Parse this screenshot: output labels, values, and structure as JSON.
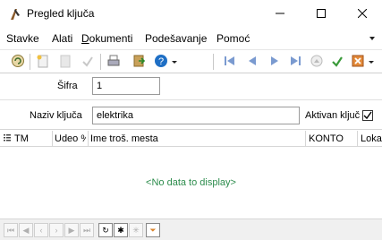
{
  "window": {
    "title": "Pregled ključa",
    "icons": [
      "app-logo-icon",
      "minimize-icon",
      "maximize-icon",
      "close-icon"
    ]
  },
  "menu": {
    "items": [
      {
        "label": "Stavke"
      },
      {
        "label": "Alati"
      },
      {
        "label": "Dokumenti",
        "underline": "D",
        "rest": "okumenti"
      },
      {
        "label": "Podešavanje"
      },
      {
        "label": "Pomoć"
      }
    ]
  },
  "toolbar": {
    "icons": [
      "refresh-icon",
      "new-icon",
      "edit-icon",
      "approve-icon",
      "print-icon",
      "export-icon",
      "help-icon",
      "first-icon",
      "prev-icon",
      "next-icon",
      "last-icon",
      "up-icon",
      "save-icon",
      "cancel-icon"
    ]
  },
  "form": {
    "sifra_label": "Šifra",
    "sifra_value": "1",
    "naziv_label": "Naziv ključa",
    "naziv_value": "elektrika",
    "aktivan_label": "Aktivan ključ",
    "aktivan_checked": true
  },
  "grid": {
    "columns": [
      "TM",
      "Udeo %",
      "Ime troš. mesta",
      "KONTO",
      "Loka"
    ],
    "empty_text": "<No data to display>"
  },
  "navigator": {
    "icons": [
      "nav-first-icon",
      "nav-prev-page-icon",
      "nav-prev-icon",
      "nav-next-icon",
      "nav-next-page-icon",
      "nav-last-icon",
      "nav-refresh-icon",
      "nav-insert-icon",
      "nav-clear-icon",
      "nav-filter-icon"
    ]
  },
  "colors": {
    "nodata_text": "#2c8c4c",
    "accent_blue": "#1f6fc5"
  }
}
